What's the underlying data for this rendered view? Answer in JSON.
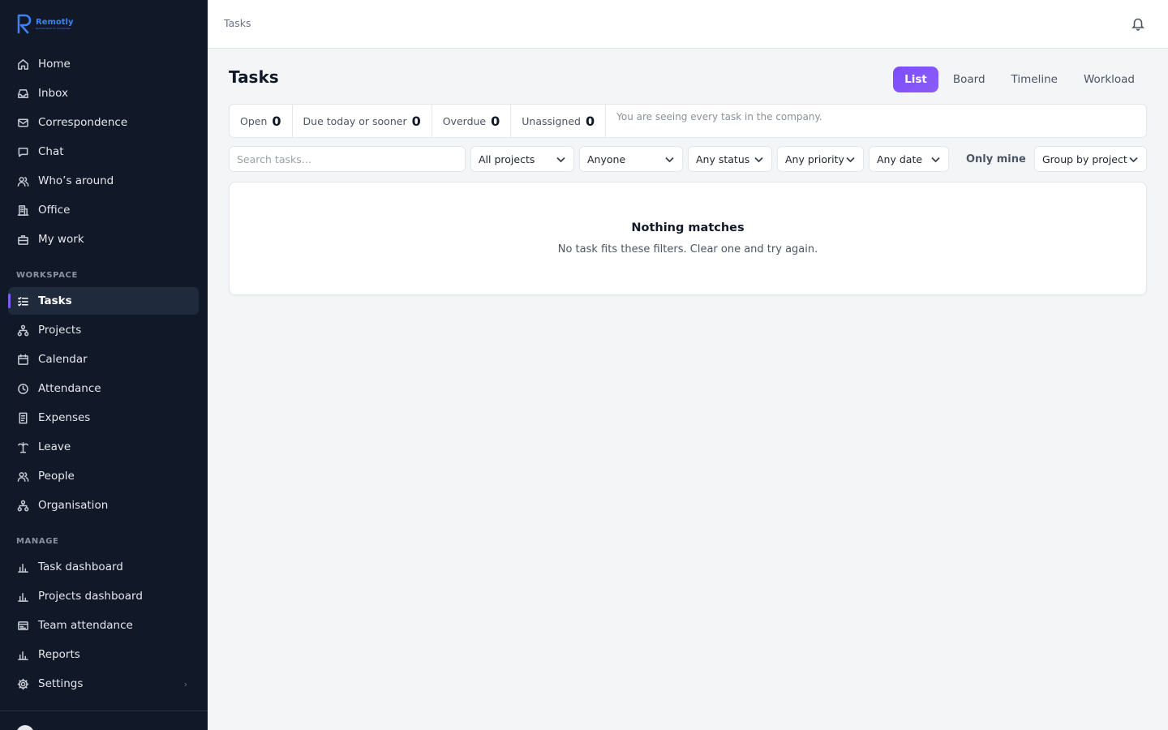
{
  "brand": {
    "name": "Remotly",
    "tagline": "Remote Work for Companies",
    "color": "#3b82f6"
  },
  "sidebar": {
    "items_top": [
      {
        "label": "Home",
        "icon": "home-icon"
      },
      {
        "label": "Inbox",
        "icon": "inbox-icon"
      },
      {
        "label": "Correspondence",
        "icon": "mail-icon"
      },
      {
        "label": "Chat",
        "icon": "chat-icon"
      },
      {
        "label": "Who’s around",
        "icon": "users-icon"
      },
      {
        "label": "Office",
        "icon": "building-icon"
      },
      {
        "label": "My work",
        "icon": "briefcase-icon"
      }
    ],
    "workspace_label": "WORKSPACE",
    "workspace_items": [
      {
        "label": "Tasks",
        "icon": "tasks-icon",
        "active": true
      },
      {
        "label": "Projects",
        "icon": "hierarchy-icon"
      },
      {
        "label": "Calendar",
        "icon": "calendar-icon"
      },
      {
        "label": "Attendance",
        "icon": "clock-icon"
      },
      {
        "label": "Expenses",
        "icon": "receipt-icon"
      },
      {
        "label": "Leave",
        "icon": "palm-tree-icon"
      },
      {
        "label": "People",
        "icon": "people-icon"
      },
      {
        "label": "Organisation",
        "icon": "org-chart-icon"
      }
    ],
    "manage_label": "MANAGE",
    "manage_items": [
      {
        "label": "Task dashboard",
        "icon": "bar-chart-icon"
      },
      {
        "label": "Projects dashboard",
        "icon": "bar-chart-icon"
      },
      {
        "label": "Team attendance",
        "icon": "id-card-icon"
      },
      {
        "label": "Reports",
        "icon": "bar-chart-icon"
      },
      {
        "label": "Settings",
        "icon": "gear-icon"
      }
    ],
    "active_accent": "#7c5cf5"
  },
  "header": {
    "breadcrumb": "Tasks",
    "bell_icon": "bell-icon"
  },
  "main": {
    "title": "Tasks",
    "view_tabs": [
      {
        "label": "List",
        "active": true
      },
      {
        "label": "Board"
      },
      {
        "label": "Timeline"
      },
      {
        "label": "Workload"
      }
    ],
    "stats": [
      {
        "label": "Open",
        "value": "0"
      },
      {
        "label": "Due today or sooner",
        "value": "0"
      },
      {
        "label": "Overdue",
        "value": "0"
      },
      {
        "label": "Unassigned",
        "value": "0"
      }
    ],
    "stats_note": "You are seeing every task in the company.",
    "filters": {
      "search_placeholder": "Search tasks…",
      "project": "All projects",
      "assignee": "Anyone",
      "status": "Any status",
      "priority": "Any priority",
      "date": "Any date",
      "only_mine": "Only mine",
      "group_by": "Group by project"
    },
    "empty_state": {
      "title": "Nothing matches",
      "subtitle": "No task fits these filters. Clear one and try again."
    }
  }
}
